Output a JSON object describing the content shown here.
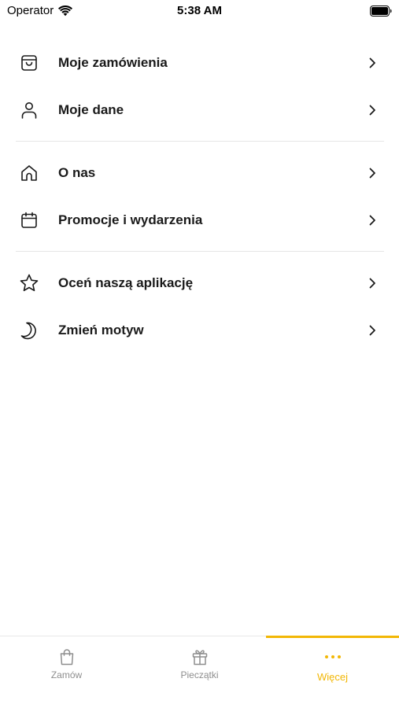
{
  "status_bar": {
    "carrier": "Operator",
    "time": "5:38 AM",
    "wifi_icon": "wifi-icon",
    "battery_icon": "battery-icon"
  },
  "menu": {
    "groups": [
      {
        "items": [
          {
            "icon": "shopping-bag-icon",
            "label": "Moje zamówienia"
          },
          {
            "icon": "user-icon",
            "label": "Moje dane"
          }
        ]
      },
      {
        "items": [
          {
            "icon": "home-icon",
            "label": "O nas"
          },
          {
            "icon": "calendar-icon",
            "label": "Promocje i wydarzenia"
          }
        ]
      },
      {
        "items": [
          {
            "icon": "star-icon",
            "label": "Oceń naszą aplikację"
          },
          {
            "icon": "moon-icon",
            "label": "Zmień motyw"
          }
        ]
      }
    ],
    "chevron_icon": "chevron-right-icon"
  },
  "tab_bar": {
    "tabs": [
      {
        "icon": "shopping-bag-icon",
        "label": "Zamów",
        "active": false
      },
      {
        "icon": "gift-icon",
        "label": "Pieczątki",
        "active": false
      },
      {
        "icon": "more-dots-icon",
        "label": "Więcej",
        "active": true
      }
    ]
  },
  "colors": {
    "accent": "#f2b705",
    "text": "#1a1a1a",
    "inactive": "#8e8e8e",
    "divider": "#e6e6e6"
  }
}
